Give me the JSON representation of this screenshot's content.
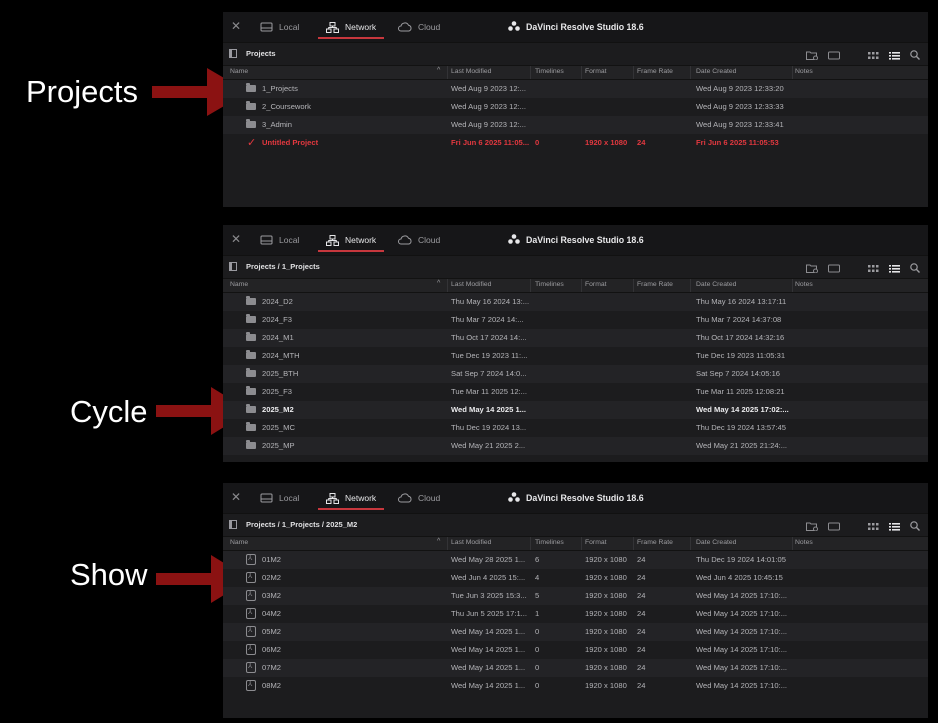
{
  "callouts": [
    {
      "label": "Projects"
    },
    {
      "label": "Cycle"
    },
    {
      "label": "Show"
    }
  ],
  "window": {
    "app_title": "DaVinci Resolve Studio 18.6",
    "tabs": [
      {
        "label": "Local"
      },
      {
        "label": "Network"
      },
      {
        "label": "Cloud"
      }
    ],
    "active_tab": "Network",
    "accent_color": "#c7373d",
    "columns": {
      "name": "Name",
      "last_modified": "Last Modified",
      "timelines": "Timelines",
      "format": "Format",
      "frame_rate": "Frame Rate",
      "date_created": "Date Created",
      "notes": "Notes"
    }
  },
  "panels": [
    {
      "breadcrumb": "Projects",
      "rows": [
        {
          "name": "1_Projects",
          "last_modified": "Wed Aug 9 2023 12:...",
          "timelines": "",
          "format": "",
          "frame_rate": "",
          "date_created": "Wed Aug 9 2023 12:33:20",
          "icon": "folder-icon"
        },
        {
          "name": "2_Coursework",
          "last_modified": "Wed Aug 9 2023 12:...",
          "timelines": "",
          "format": "",
          "frame_rate": "",
          "date_created": "Wed Aug 9 2023 12:33:33",
          "icon": "folder-icon"
        },
        {
          "name": "3_Admin",
          "last_modified": "Wed Aug 9 2023 12:...",
          "timelines": "",
          "format": "",
          "frame_rate": "",
          "date_created": "Wed Aug 9 2023 12:33:41",
          "icon": "folder-icon"
        },
        {
          "name": "Untitled Project",
          "last_modified": "Fri Jun 6 2025 11:05...",
          "timelines": "0",
          "format": "1920 x 1080",
          "frame_rate": "24",
          "date_created": "Fri Jun 6 2025 11:05:53",
          "icon": "check-icon",
          "style": "red"
        }
      ]
    },
    {
      "breadcrumb": "Projects / 1_Projects",
      "rows": [
        {
          "name": "2024_D2",
          "last_modified": "Thu May 16 2024 13:...",
          "timelines": "",
          "format": "",
          "frame_rate": "",
          "date_created": "Thu May 16 2024 13:17:11",
          "icon": "folder-icon"
        },
        {
          "name": "2024_F3",
          "last_modified": "Thu Mar 7 2024 14:...",
          "timelines": "",
          "format": "",
          "frame_rate": "",
          "date_created": "Thu Mar 7 2024 14:37:08",
          "icon": "folder-icon"
        },
        {
          "name": "2024_M1",
          "last_modified": "Thu Oct 17 2024 14:...",
          "timelines": "",
          "format": "",
          "frame_rate": "",
          "date_created": "Thu Oct 17 2024 14:32:16",
          "icon": "folder-icon"
        },
        {
          "name": "2024_MTH",
          "last_modified": "Tue Dec 19 2023 11:...",
          "timelines": "",
          "format": "",
          "frame_rate": "",
          "date_created": "Tue Dec 19 2023 11:05:31",
          "icon": "folder-icon"
        },
        {
          "name": "2025_BTH",
          "last_modified": "Sat Sep 7 2024 14:0...",
          "timelines": "",
          "format": "",
          "frame_rate": "",
          "date_created": "Sat Sep 7 2024 14:05:16",
          "icon": "folder-icon"
        },
        {
          "name": "2025_F3",
          "last_modified": "Tue Mar 11 2025 12:...",
          "timelines": "",
          "format": "",
          "frame_rate": "",
          "date_created": "Tue Mar 11 2025 12:08:21",
          "icon": "folder-icon"
        },
        {
          "name": "2025_M2",
          "last_modified": "Wed May 14 2025 1...",
          "timelines": "",
          "format": "",
          "frame_rate": "",
          "date_created": "Wed May 14 2025 17:02:...",
          "icon": "folder-icon",
          "style": "bold"
        },
        {
          "name": "2025_MC",
          "last_modified": "Thu Dec 19 2024 13...",
          "timelines": "",
          "format": "",
          "frame_rate": "",
          "date_created": "Thu Dec 19 2024 13:57:45",
          "icon": "folder-icon"
        },
        {
          "name": "2025_MP",
          "last_modified": "Wed May 21 2025 2...",
          "timelines": "",
          "format": "",
          "frame_rate": "",
          "date_created": "Wed May 21 2025 21:24:...",
          "icon": "folder-icon"
        }
      ]
    },
    {
      "breadcrumb": "Projects / 1_Projects / 2025_M2",
      "rows": [
        {
          "name": "01M2",
          "last_modified": "Wed May 28 2025 1...",
          "timelines": "6",
          "format": "1920 x 1080",
          "frame_rate": "24",
          "date_created": "Thu Dec 19 2024 14:01:05",
          "icon": "project-icon"
        },
        {
          "name": "02M2",
          "last_modified": "Wed Jun 4 2025 15:...",
          "timelines": "4",
          "format": "1920 x 1080",
          "frame_rate": "24",
          "date_created": "Wed Jun 4 2025 10:45:15",
          "icon": "project-icon"
        },
        {
          "name": "03M2",
          "last_modified": "Tue Jun 3 2025 15:3...",
          "timelines": "5",
          "format": "1920 x 1080",
          "frame_rate": "24",
          "date_created": "Wed May 14 2025 17:10:...",
          "icon": "project-icon"
        },
        {
          "name": "04M2",
          "last_modified": "Thu Jun 5 2025 17:1...",
          "timelines": "1",
          "format": "1920 x 1080",
          "frame_rate": "24",
          "date_created": "Wed May 14 2025 17:10:...",
          "icon": "project-icon"
        },
        {
          "name": "05M2",
          "last_modified": "Wed May 14 2025 1...",
          "timelines": "0",
          "format": "1920 x 1080",
          "frame_rate": "24",
          "date_created": "Wed May 14 2025 17:10:...",
          "icon": "project-icon"
        },
        {
          "name": "06M2",
          "last_modified": "Wed May 14 2025 1...",
          "timelines": "0",
          "format": "1920 x 1080",
          "frame_rate": "24",
          "date_created": "Wed May 14 2025 17:10:...",
          "icon": "project-icon"
        },
        {
          "name": "07M2",
          "last_modified": "Wed May 14 2025 1...",
          "timelines": "0",
          "format": "1920 x 1080",
          "frame_rate": "24",
          "date_created": "Wed May 14 2025 17:10:...",
          "icon": "project-icon"
        },
        {
          "name": "08M2",
          "last_modified": "Wed May 14 2025 1...",
          "timelines": "0",
          "format": "1920 x 1080",
          "frame_rate": "24",
          "date_created": "Wed May 14 2025 17:10:...",
          "icon": "project-icon"
        }
      ]
    }
  ]
}
